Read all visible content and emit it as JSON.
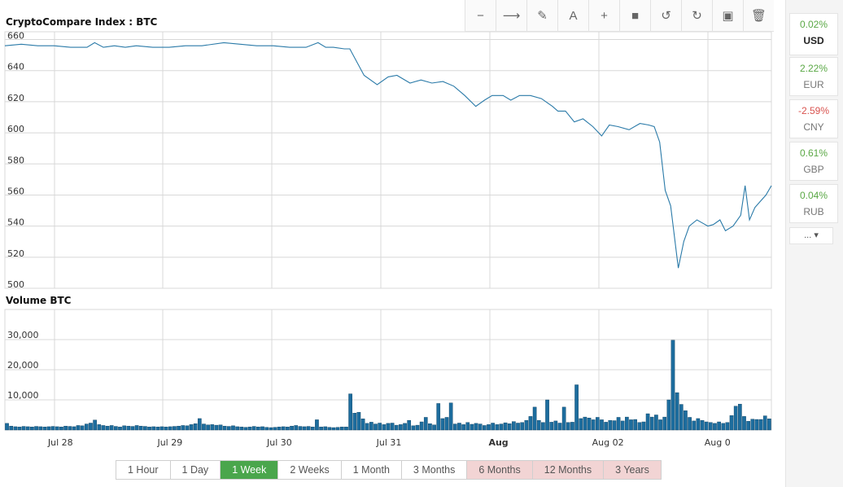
{
  "colors": {
    "line": "#2a7aa8",
    "bar_fill": "#1d6d9e",
    "bar_stroke": "#0b3e5e",
    "grid": "#d8d8d8",
    "active": "#4aa64c",
    "premium": "#f2d4d4",
    "positive": "#5aa845",
    "negative": "#d9534f"
  },
  "toolbar": [
    {
      "icon": "minus-icon",
      "glyph": "−"
    },
    {
      "icon": "arrow-right-icon",
      "glyph": "⟶"
    },
    {
      "icon": "pencil-icon",
      "glyph": "✎"
    },
    {
      "icon": "text-icon",
      "glyph": "A"
    },
    {
      "icon": "plus-icon",
      "glyph": "+"
    },
    {
      "icon": "square-icon",
      "glyph": "■"
    },
    {
      "icon": "undo-icon",
      "glyph": "↺"
    },
    {
      "icon": "redo-icon",
      "glyph": "↻"
    },
    {
      "icon": "save-icon",
      "glyph": "▣"
    },
    {
      "icon": "trash-icon",
      "glyph": "🗑"
    }
  ],
  "ranges": [
    {
      "label": "1 Hour",
      "state": "normal"
    },
    {
      "label": "1 Day",
      "state": "normal"
    },
    {
      "label": "1 Week",
      "state": "active"
    },
    {
      "label": "2 Weeks",
      "state": "normal"
    },
    {
      "label": "1 Month",
      "state": "normal"
    },
    {
      "label": "3 Months",
      "state": "normal"
    },
    {
      "label": "6 Months",
      "state": "premium"
    },
    {
      "label": "12 Months",
      "state": "premium"
    },
    {
      "label": "3 Years",
      "state": "premium"
    }
  ],
  "currencies": [
    {
      "code": "USD",
      "change": "0.02%",
      "dir": "pos",
      "selected": true
    },
    {
      "code": "EUR",
      "change": "2.22%",
      "dir": "pos",
      "selected": false
    },
    {
      "code": "CNY",
      "change": "-2.59%",
      "dir": "neg",
      "selected": false
    },
    {
      "code": "GBP",
      "change": "0.61%",
      "dir": "pos",
      "selected": false
    },
    {
      "code": "RUB",
      "change": "0.04%",
      "dir": "pos",
      "selected": false
    }
  ],
  "more_label": "... ▾",
  "chart_data": [
    {
      "type": "line",
      "title": "CryptoCompare Index : BTC",
      "ylim": [
        500,
        665
      ],
      "yticks": [
        500,
        520,
        540,
        560,
        580,
        600,
        620,
        640,
        660
      ],
      "xlim": [
        0,
        7
      ],
      "xticks": [
        {
          "x": 0.5,
          "label": "Jul 28",
          "bold": false
        },
        {
          "x": 1.5,
          "label": "Jul 29",
          "bold": false
        },
        {
          "x": 2.5,
          "label": "Jul 30",
          "bold": false
        },
        {
          "x": 3.5,
          "label": "Jul 31",
          "bold": false
        },
        {
          "x": 4.5,
          "label": "Aug",
          "bold": true
        },
        {
          "x": 5.5,
          "label": "Aug 02",
          "bold": false
        },
        {
          "x": 6.5,
          "label": "Aug 0",
          "bold": false
        }
      ],
      "grid": true,
      "points": [
        [
          0.0,
          656
        ],
        [
          0.15,
          657
        ],
        [
          0.3,
          656
        ],
        [
          0.45,
          656
        ],
        [
          0.6,
          655
        ],
        [
          0.75,
          655
        ],
        [
          0.82,
          658
        ],
        [
          0.9,
          655
        ],
        [
          1.0,
          656
        ],
        [
          1.1,
          655
        ],
        [
          1.2,
          656
        ],
        [
          1.35,
          655
        ],
        [
          1.5,
          655
        ],
        [
          1.65,
          656
        ],
        [
          1.8,
          656
        ],
        [
          2.0,
          658
        ],
        [
          2.15,
          657
        ],
        [
          2.3,
          656
        ],
        [
          2.45,
          656
        ],
        [
          2.6,
          655
        ],
        [
          2.75,
          655
        ],
        [
          2.86,
          658
        ],
        [
          2.93,
          655
        ],
        [
          3.0,
          655
        ],
        [
          3.1,
          654
        ],
        [
          3.15,
          654
        ],
        [
          3.28,
          637
        ],
        [
          3.4,
          631
        ],
        [
          3.5,
          636
        ],
        [
          3.58,
          637
        ],
        [
          3.7,
          632
        ],
        [
          3.8,
          634
        ],
        [
          3.9,
          632
        ],
        [
          4.0,
          633
        ],
        [
          4.1,
          630
        ],
        [
          4.2,
          624
        ],
        [
          4.3,
          617
        ],
        [
          4.38,
          621
        ],
        [
          4.45,
          624
        ],
        [
          4.55,
          624
        ],
        [
          4.62,
          621
        ],
        [
          4.7,
          624
        ],
        [
          4.8,
          624
        ],
        [
          4.9,
          622
        ],
        [
          5.0,
          617
        ],
        [
          5.05,
          614
        ],
        [
          5.12,
          614
        ],
        [
          5.2,
          607
        ],
        [
          5.28,
          609
        ],
        [
          5.37,
          604
        ],
        [
          5.45,
          598
        ],
        [
          5.52,
          605
        ],
        [
          5.6,
          604
        ],
        [
          5.7,
          602
        ],
        [
          5.8,
          606
        ],
        [
          5.88,
          605
        ],
        [
          5.93,
          604
        ],
        [
          5.98,
          594
        ],
        [
          6.03,
          563
        ],
        [
          6.08,
          553
        ],
        [
          6.15,
          513
        ],
        [
          6.2,
          530
        ],
        [
          6.25,
          540
        ],
        [
          6.32,
          544
        ],
        [
          6.37,
          542
        ],
        [
          6.42,
          540
        ],
        [
          6.47,
          541
        ],
        [
          6.53,
          544
        ],
        [
          6.58,
          537
        ],
        [
          6.65,
          540
        ],
        [
          6.72,
          547
        ],
        [
          6.76,
          566
        ],
        [
          6.8,
          544
        ],
        [
          6.85,
          552
        ],
        [
          6.9,
          556
        ],
        [
          6.95,
          560
        ],
        [
          7.0,
          566
        ]
      ]
    },
    {
      "type": "bar",
      "title": "Volume BTC",
      "ylim": [
        0,
        40000
      ],
      "yticks": [
        10000,
        20000,
        30000
      ],
      "ytick_labels": [
        "10,000",
        "20,000",
        "30,000"
      ],
      "xlim": [
        0,
        7
      ],
      "grid": true,
      "values": [
        2200,
        1300,
        1100,
        1000,
        1200,
        1100,
        1000,
        1200,
        1100,
        1000,
        1100,
        1200,
        1100,
        1000,
        1300,
        1200,
        1100,
        1500,
        1400,
        2000,
        2300,
        3300,
        1800,
        1500,
        1300,
        1500,
        1200,
        1000,
        1400,
        1300,
        1200,
        1500,
        1300,
        1200,
        1000,
        1100,
        1000,
        1100,
        1000,
        1100,
        1200,
        1300,
        1500,
        1400,
        1800,
        2100,
        3800,
        2000,
        1700,
        1800,
        1600,
        1700,
        1300,
        1200,
        1400,
        1100,
        1000,
        900,
        1000,
        1200,
        1000,
        1100,
        900,
        800,
        900,
        1000,
        1100,
        1000,
        1300,
        1500,
        1200,
        1100,
        1200,
        1000,
        3400,
        1000,
        1100,
        900,
        800,
        900,
        1000,
        1000,
        12000,
        5600,
        5900,
        3700,
        2200,
        2600,
        2000,
        2300,
        1800,
        2200,
        2300,
        1600,
        1800,
        2200,
        3200,
        1400,
        1600,
        2700,
        4200,
        2100,
        1700,
        8800,
        3800,
        4200,
        9000,
        2000,
        2300,
        1800,
        2500,
        1900,
        2200,
        2000,
        1500,
        1800,
        2300,
        1800,
        2000,
        2400,
        2100,
        2800,
        2300,
        2500,
        3200,
        4500,
        7600,
        3200,
        2500,
        10000,
        2600,
        3000,
        2300,
        7600,
        2500,
        2600,
        15000,
        3800,
        4300,
        4000,
        3400,
        4200,
        3400,
        2600,
        3200,
        3100,
        4200,
        3000,
        4300,
        3400,
        3500,
        2500,
        2700,
        5400,
        4300,
        5000,
        3400,
        4300,
        10000,
        29800,
        12400,
        8500,
        6400,
        4200,
        3000,
        3800,
        3200,
        2700,
        2500,
        2200,
        2700,
        2200,
        2500,
        4800,
        7900,
        8600,
        4500,
        2900,
        3600,
        3500,
        3500,
        4700,
        3700
      ]
    }
  ]
}
